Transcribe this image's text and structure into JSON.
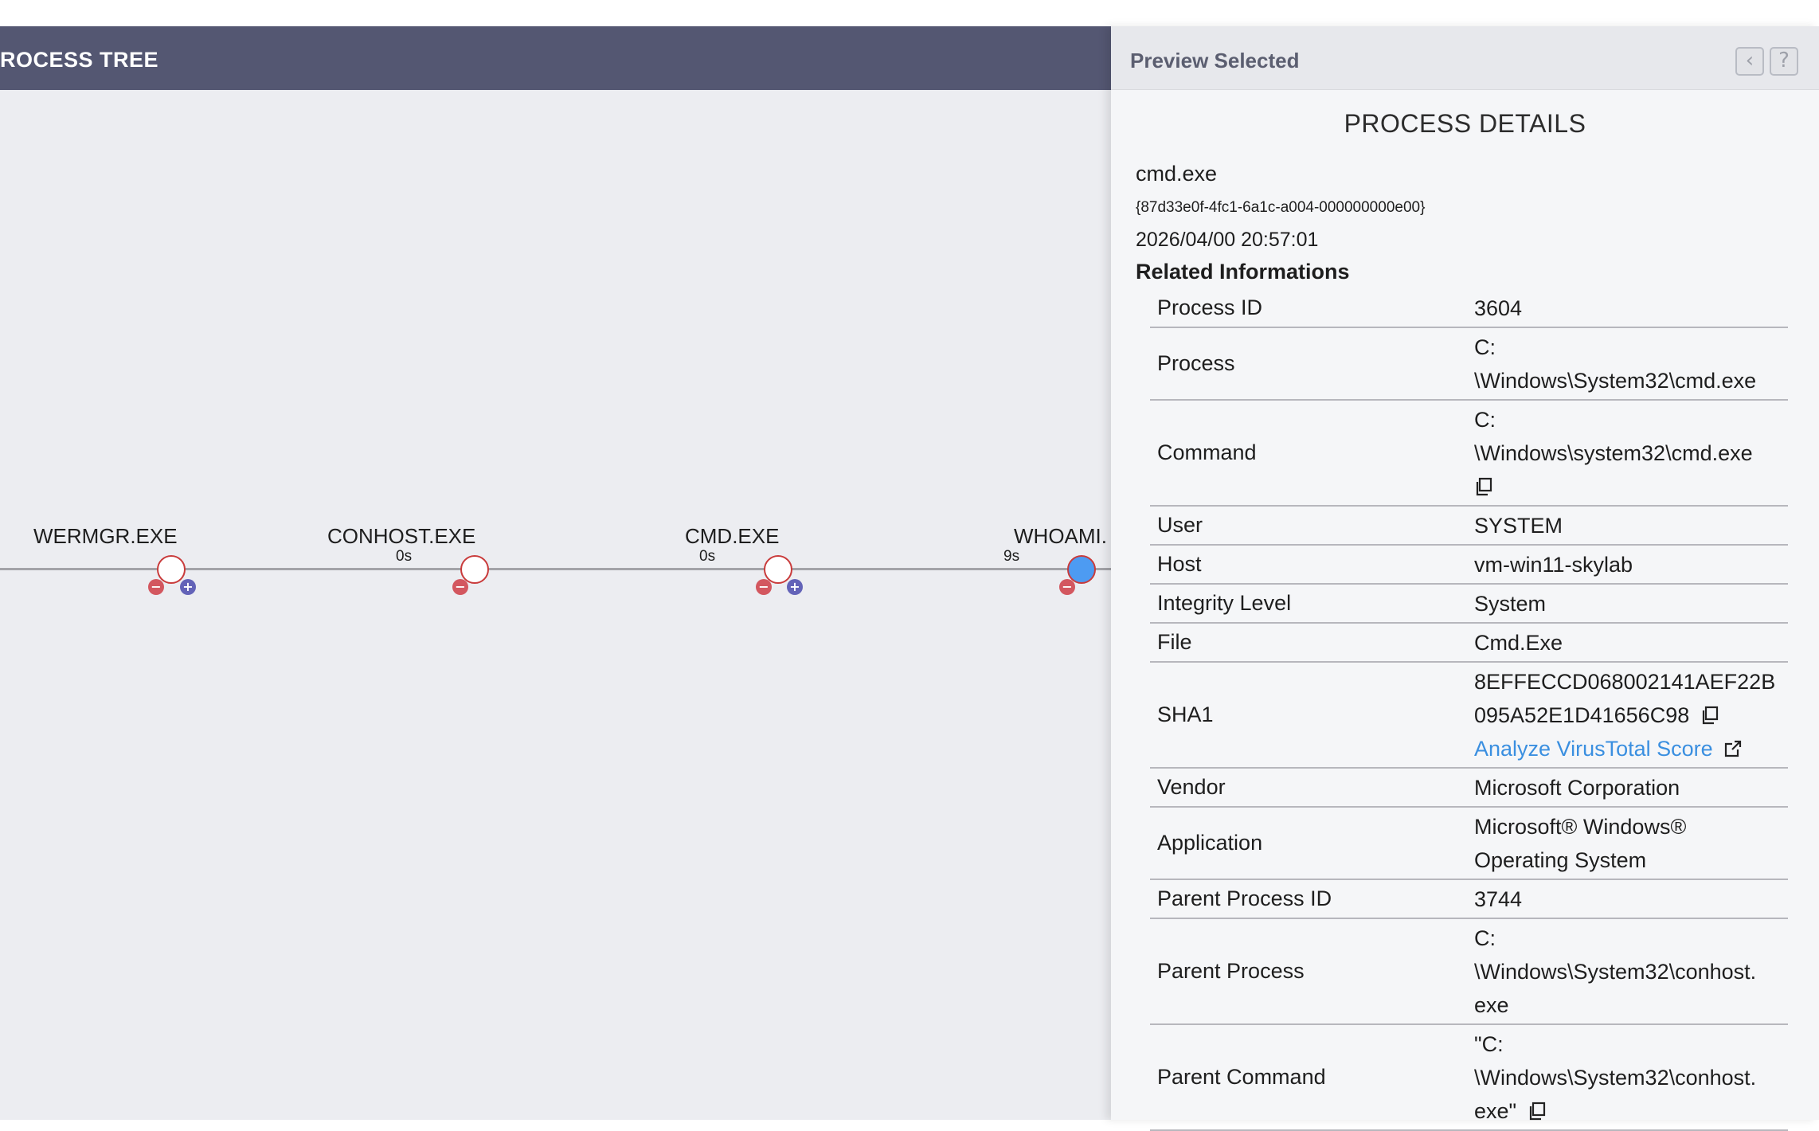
{
  "tree": {
    "title": "ROCESS TREE",
    "nodes": [
      {
        "label": "WERMGR.EXE",
        "time": "",
        "minus": "−",
        "plus": "+"
      },
      {
        "label": "CONHOST.EXE",
        "time": "0s",
        "minus": "−",
        "plus": ""
      },
      {
        "label": "CMD.EXE",
        "time": "0s",
        "minus": "−",
        "plus": "+"
      },
      {
        "label": "WHOAMI.",
        "time": "9s",
        "minus": "−",
        "plus": ""
      }
    ]
  },
  "preview": {
    "title": "Preview Selected",
    "back_icon": "‹",
    "help_icon": "?",
    "heading": "PROCESS DETAILS",
    "name": "cmd.exe",
    "guid": "{87d33e0f-4fc1-6a1c-a004-000000000e00}",
    "timestamp": "2026/04/00 20:57:01",
    "related_title": "Related Informations",
    "rows": {
      "process_id": {
        "key": "Process ID",
        "value": "3604"
      },
      "process": {
        "key": "Process",
        "line1": "C:",
        "line2": "\\Windows\\System32\\cmd.exe"
      },
      "command": {
        "key": "Command",
        "line1": "C:",
        "line2": "\\Windows\\system32\\cmd.exe"
      },
      "user": {
        "key": "User",
        "value": "SYSTEM"
      },
      "host": {
        "key": "Host",
        "value": "vm-win11-skylab"
      },
      "integrity": {
        "key": "Integrity Level",
        "value": "System"
      },
      "file": {
        "key": "File",
        "value": "Cmd.Exe"
      },
      "sha1": {
        "key": "SHA1",
        "line1": "8EFFECCD068002141AEF22B",
        "line2": "095A52E1D41656C98",
        "link": "Analyze VirusTotal Score"
      },
      "vendor": {
        "key": "Vendor",
        "value": "Microsoft Corporation"
      },
      "application": {
        "key": "Application",
        "line1": "Microsoft® Windows®",
        "line2": "Operating System"
      },
      "parent_pid": {
        "key": "Parent Process ID",
        "value": "3744"
      },
      "parent_process": {
        "key": "Parent Process",
        "line1": "C:",
        "line2": "\\Windows\\System32\\conhost.",
        "line3": "exe"
      },
      "parent_command": {
        "key": "Parent Command",
        "line1": "\"C:",
        "line2": "\\Windows\\System32\\conhost.",
        "line3": "exe\""
      }
    }
  }
}
